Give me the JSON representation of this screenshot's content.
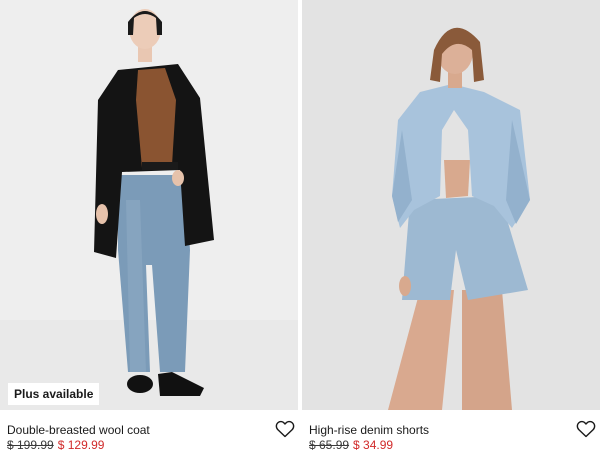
{
  "products": [
    {
      "name": "Double-breasted wool coat",
      "price_original": "$ 199.99",
      "price_sale": "$ 129.99",
      "badge": "Plus available",
      "favorite_icon": "heart-outline-icon",
      "sale_color": "#d12a2a"
    },
    {
      "name": "High-rise denim shorts",
      "price_original": "$ 65.99",
      "price_sale": "$ 34.99",
      "favorite_icon": "heart-outline-icon",
      "sale_color": "#d12a2a"
    }
  ]
}
